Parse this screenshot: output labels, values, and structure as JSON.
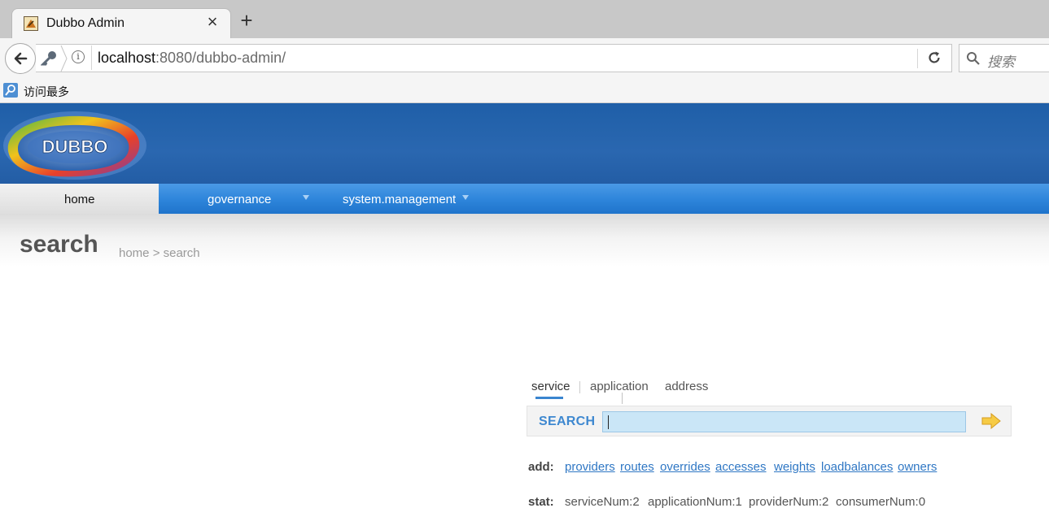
{
  "browser": {
    "tab_title": "Dubbo Admin",
    "url_host": "localhost",
    "url_rest": ":8080/dubbo-admin/",
    "search_placeholder": "搜索",
    "bookmark_label": "访问最多"
  },
  "header": {
    "logo_text": "DUBBO"
  },
  "menu": {
    "home": "home",
    "governance": "governance",
    "system": "system.management"
  },
  "page": {
    "title": "search",
    "breadcrumb": "home > search"
  },
  "search": {
    "tabs": [
      "service",
      "application",
      "address"
    ],
    "label": "SEARCH",
    "value": ""
  },
  "add": {
    "label": "add:",
    "links": [
      "providers",
      "routes",
      "overrides",
      "accesses",
      "weights",
      "loadbalances",
      "owners"
    ]
  },
  "stat": {
    "label": "stat:",
    "items": [
      "serviceNum:2",
      "applicationNum:1",
      "providerNum:2",
      "consumerNum:0"
    ]
  },
  "colors": {
    "header_blue": "#2a67b0",
    "menu_blue": "#2d84da",
    "link_blue": "#2f77c4",
    "search_field": "#cae6f7"
  }
}
